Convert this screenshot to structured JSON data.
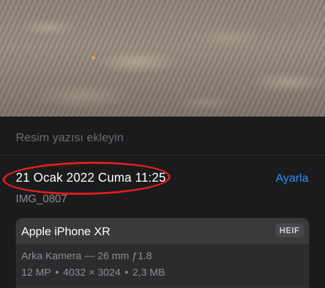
{
  "photo": {
    "description_icon": "photo-preview"
  },
  "caption": {
    "placeholder": "Resim yazısı ekleyin"
  },
  "info": {
    "datetime": "21 Ocak 2022 Cuma 11:25",
    "adjust_label": "Ayarla",
    "filename": "IMG_0807"
  },
  "device": {
    "name": "Apple iPhone XR",
    "format": "HEIF",
    "lens": "Arka Kamera — 26 mm ƒ1.8",
    "megapixels": "12 MP",
    "resolution": "4032 × 3024",
    "filesize": "2,3 MB",
    "separator": "•"
  },
  "colors": {
    "background": "#1c1c1e",
    "accent": "#2f8ef2",
    "annotation": "#e3201b"
  }
}
